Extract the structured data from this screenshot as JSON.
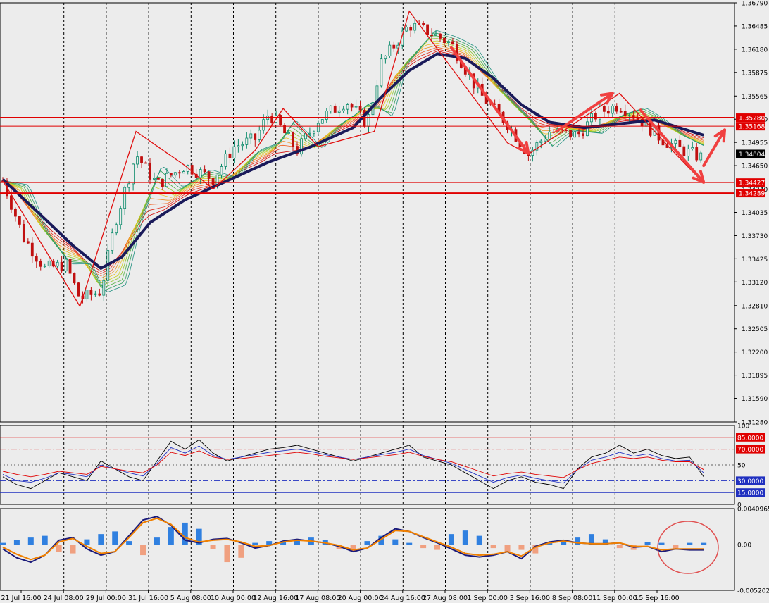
{
  "chart_data": {
    "type": "candlestick",
    "main": {
      "ylim": [
        1.3128,
        1.3679
      ],
      "price_ticks": [
        "1.36790",
        "1.36485",
        "1.36180",
        "1.35875",
        "1.35565",
        "1.35260",
        "1.34955",
        "1.34650",
        "1.34340",
        "1.34035",
        "1.33730",
        "1.33425",
        "1.33120",
        "1.32810",
        "1.32505",
        "1.32200",
        "1.31895",
        "1.31590",
        "1.31280"
      ],
      "level_labels": [
        {
          "value": 1.3528,
          "text": "1.35280",
          "style": "red"
        },
        {
          "value": 1.35168,
          "text": "1.35168",
          "style": "red"
        },
        {
          "value": 1.34804,
          "text": "1.34804",
          "style": "current"
        },
        {
          "value": 1.34427,
          "text": "1.34427",
          "style": "red"
        },
        {
          "value": 1.34289,
          "text": "1.34289",
          "style": "red"
        }
      ],
      "horizontal_lines": [
        {
          "value": 1.3528,
          "color": "#e00000",
          "width": 2
        },
        {
          "value": 1.35168,
          "color": "#e00000",
          "width": 1
        },
        {
          "value": 1.34804,
          "color": "#3060d0",
          "width": 1
        },
        {
          "value": 1.34427,
          "color": "#e00000",
          "width": 1
        },
        {
          "value": 1.34289,
          "color": "#e00000",
          "width": 2
        }
      ],
      "zigzag": [
        [
          0,
          1.3445
        ],
        [
          11,
          1.328
        ],
        [
          19,
          1.351
        ],
        [
          26,
          1.3465
        ],
        [
          30,
          1.3434
        ],
        [
          36,
          1.3485
        ],
        [
          40,
          1.354
        ],
        [
          45,
          1.349
        ],
        [
          53,
          1.351
        ],
        [
          58,
          1.3668
        ],
        [
          72,
          1.3495
        ],
        [
          75,
          1.348
        ],
        [
          88,
          1.356
        ],
        [
          95,
          1.349
        ],
        [
          100,
          1.3442
        ]
      ],
      "arrows": [
        {
          "from": [
            64,
            1.362
          ],
          "to": [
            75,
            1.3481
          ]
        },
        {
          "from": [
            79,
            1.351
          ],
          "to": [
            87,
            1.356
          ]
        },
        {
          "from": [
            91,
            1.3538
          ],
          "to": [
            100,
            1.3443
          ]
        },
        {
          "from": [
            100,
            1.3465
          ],
          "to": [
            103,
            1.3512
          ]
        }
      ],
      "price_path": [
        [
          0,
          1.3445
        ],
        [
          3,
          1.337
        ],
        [
          6,
          1.333
        ],
        [
          9,
          1.3335
        ],
        [
          11,
          1.329
        ],
        [
          14,
          1.33
        ],
        [
          16,
          1.339
        ],
        [
          19,
          1.348
        ],
        [
          22,
          1.344
        ],
        [
          26,
          1.3465
        ],
        [
          30,
          1.3448
        ],
        [
          33,
          1.349
        ],
        [
          36,
          1.35
        ],
        [
          38,
          1.3535
        ],
        [
          40,
          1.351
        ],
        [
          42,
          1.3485
        ],
        [
          45,
          1.3525
        ],
        [
          49,
          1.355
        ],
        [
          52,
          1.352
        ],
        [
          54,
          1.36
        ],
        [
          58,
          1.365
        ],
        [
          61,
          1.364
        ],
        [
          64,
          1.3625
        ],
        [
          68,
          1.356
        ],
        [
          72,
          1.352
        ],
        [
          75,
          1.348
        ],
        [
          78,
          1.351
        ],
        [
          82,
          1.3505
        ],
        [
          85,
          1.3535
        ],
        [
          88,
          1.3545
        ],
        [
          91,
          1.3525
        ],
        [
          94,
          1.35
        ],
        [
          97,
          1.3485
        ],
        [
          100,
          1.3475
        ]
      ],
      "ma_path": [
        [
          0,
          1.3447
        ],
        [
          6,
          1.3395
        ],
        [
          10,
          1.336
        ],
        [
          14,
          1.333
        ],
        [
          17,
          1.3345
        ],
        [
          21,
          1.339
        ],
        [
          26,
          1.342
        ],
        [
          32,
          1.3445
        ],
        [
          38,
          1.347
        ],
        [
          44,
          1.349
        ],
        [
          50,
          1.3515
        ],
        [
          54,
          1.3555
        ],
        [
          58,
          1.359
        ],
        [
          62,
          1.3612
        ],
        [
          66,
          1.3606
        ],
        [
          70,
          1.358
        ],
        [
          74,
          1.3545
        ],
        [
          78,
          1.3522
        ],
        [
          83,
          1.3515
        ],
        [
          88,
          1.352
        ],
        [
          93,
          1.3525
        ],
        [
          100,
          1.3505
        ]
      ]
    },
    "rsi": {
      "ylim": [
        0,
        100
      ],
      "ticks": [
        "100",
        "50",
        "0"
      ],
      "levels": [
        {
          "value": 85,
          "text": "85.0000",
          "color": "#e00000",
          "dash": false,
          "bg": "#e00000"
        },
        {
          "value": 70,
          "text": "70.0000",
          "color": "#e00000",
          "dash": true,
          "bg": "#e00000"
        },
        {
          "value": 30,
          "text": "30.0000",
          "color": "#2030c0",
          "dash": true,
          "bg": "#2030c0"
        },
        {
          "value": 15,
          "text": "15.0000",
          "color": "#2030c0",
          "dash": false,
          "bg": "#2030c0"
        }
      ],
      "series": [
        {
          "color": "#000000",
          "values": [
            35,
            25,
            20,
            30,
            40,
            35,
            30,
            55,
            45,
            35,
            30,
            55,
            80,
            70,
            82,
            65,
            55,
            60,
            65,
            70,
            72,
            75,
            70,
            65,
            60,
            55,
            60,
            65,
            70,
            75,
            60,
            55,
            50,
            40,
            30,
            20,
            30,
            35,
            28,
            25,
            20,
            45,
            60,
            65,
            75,
            65,
            70,
            62,
            58,
            60,
            35
          ]
        },
        {
          "color": "#2030c0",
          "values": [
            38,
            30,
            28,
            33,
            40,
            38,
            35,
            50,
            45,
            40,
            36,
            52,
            72,
            65,
            74,
            62,
            57,
            60,
            63,
            66,
            68,
            70,
            67,
            63,
            60,
            57,
            60,
            63,
            66,
            70,
            62,
            57,
            52,
            44,
            36,
            28,
            34,
            37,
            33,
            30,
            27,
            44,
            56,
            60,
            66,
            61,
            64,
            58,
            55,
            56,
            40
          ]
        },
        {
          "color": "#e00000",
          "values": [
            42,
            38,
            35,
            38,
            42,
            40,
            38,
            48,
            45,
            42,
            40,
            50,
            66,
            62,
            68,
            60,
            57,
            58,
            60,
            62,
            64,
            66,
            64,
            61,
            59,
            57,
            59,
            61,
            63,
            66,
            61,
            57,
            54,
            48,
            42,
            36,
            39,
            41,
            38,
            36,
            34,
            44,
            52,
            56,
            60,
            58,
            60,
            56,
            54,
            54,
            44
          ]
        }
      ]
    },
    "macd": {
      "ylim": [
        -0.005202,
        0.0040965
      ],
      "ticks": [
        "0.0040965",
        "0.00",
        "-0.005202"
      ],
      "histogram": [
        0.0002,
        0.0005,
        0.0008,
        0.001,
        -0.0008,
        -0.001,
        0.0006,
        0.0012,
        0.0015,
        0.0004,
        -0.0012,
        0.0008,
        0.002,
        0.0025,
        0.0018,
        -0.0005,
        -0.002,
        -0.0015,
        0.0002,
        0.0004,
        0.0003,
        0.0006,
        0.0008,
        0.0005,
        -0.0005,
        -0.0008,
        0.0004,
        0.001,
        0.0006,
        0.0002,
        -0.0004,
        -0.0006,
        0.0012,
        0.0016,
        0.001,
        -0.0004,
        -0.0008,
        -0.0006,
        -0.001,
        0.0003,
        0.0004,
        0.0008,
        0.0012,
        0.0006,
        -0.0004,
        -0.0006,
        0.0003,
        0.0002,
        -0.0005,
        0.0002,
        0.0002
      ],
      "series": [
        {
          "color": "#1a1a7a",
          "values": [
            -0.0005,
            -0.0015,
            -0.002,
            -0.0012,
            0.0005,
            0.0008,
            -0.0005,
            -0.0012,
            -0.0008,
            0.001,
            0.0028,
            0.0032,
            0.0022,
            0.0005,
            0.0002,
            0.0006,
            0.0007,
            0.0002,
            -0.0004,
            -0.0001,
            0.0004,
            0.0006,
            0.0004,
            0.0002,
            -0.0002,
            -0.0008,
            -0.0004,
            0.0008,
            0.0018,
            0.0015,
            0.0008,
            0.0002,
            -0.0005,
            -0.0012,
            -0.0014,
            -0.0012,
            -0.0008,
            -0.0016,
            -0.0002,
            0.0003,
            0.0005,
            0.0002,
            0.0001,
            0.0001,
            0.0002,
            -0.0003,
            -0.0002,
            -0.0008,
            -0.0005,
            -0.0006,
            -0.0006
          ]
        },
        {
          "color": "#f08000",
          "values": [
            -0.0003,
            -0.0011,
            -0.0017,
            -0.0012,
            0.0003,
            0.0007,
            -0.0002,
            -0.001,
            -0.0008,
            0.0008,
            0.0025,
            0.003,
            0.0023,
            0.0008,
            0.0003,
            0.0005,
            0.0006,
            0.0003,
            -0.0002,
            -0.0001,
            0.0003,
            0.0005,
            0.0004,
            0.0002,
            -0.0001,
            -0.0006,
            -0.0004,
            0.0006,
            0.0016,
            0.0015,
            0.0009,
            0.0003,
            -0.0003,
            -0.001,
            -0.0012,
            -0.0011,
            -0.0008,
            -0.0013,
            -0.0003,
            0.0002,
            0.0004,
            0.0002,
            0.0001,
            0.0001,
            0.0002,
            -0.0002,
            -0.0002,
            -0.0006,
            -0.0005,
            -0.0005,
            -0.0005
          ]
        }
      ]
    },
    "x_labels": [
      "21 Jul 16:00",
      "24 Jul 08:00",
      "29 Jul 00:00",
      "31 Jul 16:00",
      "5 Aug 08:00",
      "10 Aug 00:00",
      "12 Aug 16:00",
      "17 Aug 08:00",
      "20 Aug 00:00",
      "24 Aug 16:00",
      "27 Aug 08:00",
      "1 Sep 00:00",
      "3 Sep 16:00",
      "8 Sep 08:00",
      "11 Sep 00:00",
      "15 Sep 16:00"
    ],
    "vertical_grid_at_labels": [
      1,
      2,
      3,
      4,
      5,
      6,
      7,
      8,
      9,
      10,
      11,
      12,
      13,
      14
    ]
  },
  "colors": {
    "background": "#ececec",
    "candle_up": "#0a8a6a",
    "candle_down": "#c01010",
    "annotation": "#f04040"
  }
}
